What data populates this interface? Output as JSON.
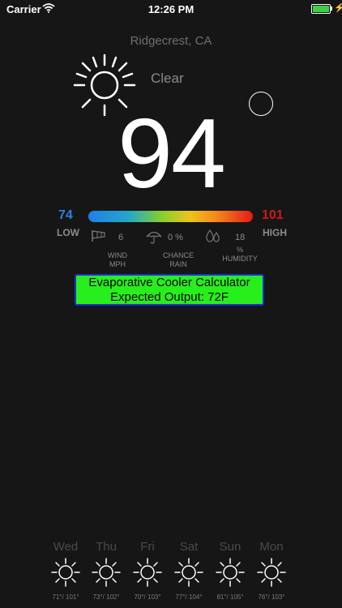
{
  "status_bar": {
    "carrier": "Carrier",
    "time": "12:26 PM",
    "battery_color": "#37d24a"
  },
  "location": "Ridgecrest, CA",
  "condition": "Clear",
  "condition_icon": "sun-icon",
  "temperature": "94",
  "range": {
    "low": "74",
    "low_label": "LOW",
    "high": "101",
    "high_label": "HIGH",
    "low_color": "#2d7fe6",
    "high_color": "#d01818"
  },
  "stats": {
    "wind": {
      "value": "6",
      "label1": "WIND",
      "label2": "MPH",
      "icon": "windsock-icon"
    },
    "rain": {
      "value": "0 %",
      "label1": "CHANCE",
      "label2": "RAIN",
      "icon": "umbrella-icon"
    },
    "humidity": {
      "value": "18",
      "label1": "%",
      "label2": "HUMIDITY",
      "icon": "drops-icon"
    }
  },
  "calculator": {
    "line1": "Evaporative Cooler Calculator",
    "line2": "Expected  Output: 72F",
    "bg_color": "#27ef1b",
    "border_color": "#1b2fd8"
  },
  "forecast": [
    {
      "day": "Wed",
      "temps": "71°/ 101°"
    },
    {
      "day": "Thu",
      "temps": "73°/ 102°"
    },
    {
      "day": "Fri",
      "temps": "70°/ 103°"
    },
    {
      "day": "Sat",
      "temps": "77°/ 104°"
    },
    {
      "day": "Sun",
      "temps": "81°/ 105°"
    },
    {
      "day": "Mon",
      "temps": "76°/ 103°"
    }
  ]
}
